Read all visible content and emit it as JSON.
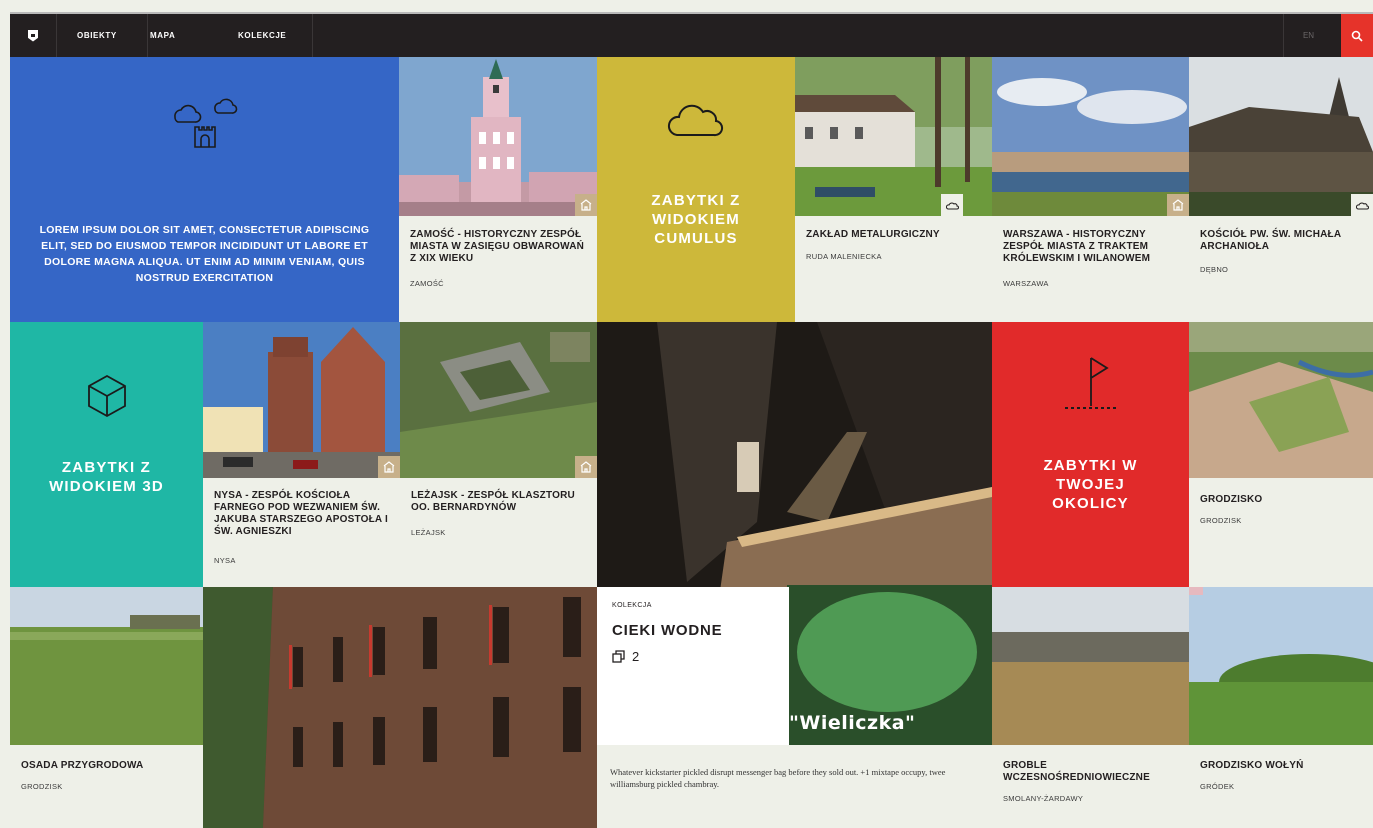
{
  "nav": {
    "items": [
      "OBIEKTY",
      "MAPA",
      "KOLEKCJE"
    ],
    "lang": "EN"
  },
  "intro": {
    "text": "LOREM IPSUM DOLOR SIT AMET, CONSECTETUR ADIPISCING ELIT, SED DO EIUSMOD TEMPOR INCIDIDUNT UT LABORE ET DOLORE MAGNA ALIQUA. UT ENIM AD MINIM VENIAM, QUIS NOSTRUD EXERCITATION",
    "color": "#3566c6"
  },
  "features": {
    "cumulus": {
      "title": "ZABYTKI Z WIDOKIEM CUMULUS",
      "color": "#cdb83a",
      "icon": "cloud-icon"
    },
    "view3d": {
      "title": "ZABYTKI Z WIDOKIEM 3D",
      "color": "#1fb7a5",
      "icon": "cube-icon"
    },
    "nearby": {
      "title": "ZABYTKI W TWOJEJ OKOLICY",
      "color": "#e12a2a",
      "icon": "flag-icon"
    }
  },
  "cards": {
    "zamosc": {
      "title": "ZAMOŚĆ - HISTORYCZNY ZESPÓŁ MIASTA W ZASIĘGU OBWAROWAŃ Z XIX WIEKU",
      "location": "ZAMOŚĆ"
    },
    "zaklad": {
      "title": "ZAKŁAD METALURGICZNY",
      "location": "RUDA MALENIECKA"
    },
    "warszawa": {
      "title": "WARSZAWA - HISTORYCZNY ZESPÓŁ MIASTA Z TRAKTEM KRÓLEWSKIM I WILANOWEM",
      "location": "WARSZAWA"
    },
    "koscielny": {
      "title": "KOŚCIÓŁ PW. ŚW. MICHAŁA ARCHANIOŁA",
      "location": "DĘBNO"
    },
    "nysa": {
      "title": "NYSA - ZESPÓŁ KOŚCIOŁA FARNEGO POD WEZWANIEM ŚW. JAKUBA STARSZEGO APOSTOŁA I ŚW. AGNIESZKI",
      "location": "NYSA"
    },
    "lezajsk": {
      "title": "LEŻAJSK - ZESPÓŁ KLASZTORU OO. BERNARDYNÓW",
      "location": "LEŻAJSK"
    },
    "grodzisko": {
      "title": "GRODZISKO",
      "location": "GRODZISK"
    },
    "osada": {
      "title": "OSADA PRZYGRODOWA",
      "location": "GRODZISK"
    },
    "groble": {
      "title": "GROBLE WCZESNOŚREDNIOWIECZNE",
      "location": "SMOLANY-ŻARDAWY"
    },
    "wolyn": {
      "title": "GRODZISKO WOŁYŃ",
      "location": "GRÓDEK"
    }
  },
  "collection": {
    "label": "KOLEKCJA",
    "title": "CIEKI WODNE",
    "count": "2",
    "caption": "\"Wieliczka\"",
    "description": "Whatever kickstarter pickled disrupt messenger bag before they sold out. +1 mixtape occupy, twee williamsburg pickled chambray."
  }
}
